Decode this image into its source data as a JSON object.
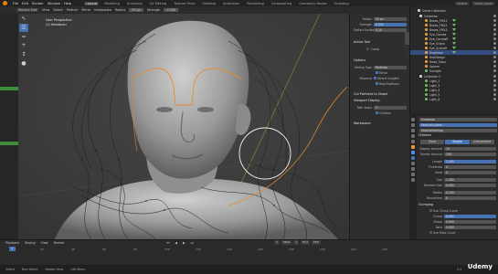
{
  "topbar": {
    "menus": [
      "File",
      "Edit",
      "Render",
      "Window",
      "Help"
    ],
    "workspaces": [
      "Layout",
      "Modeling",
      "Sculpting",
      "UV Editing",
      "Texture Paint",
      "Shading",
      "Animation",
      "Rendering",
      "Compositing",
      "Geometry Nodes",
      "Scripting"
    ],
    "active_workspace": "Layout",
    "scene": "Scene",
    "view_layer": "View Layer"
  },
  "viewport_header": {
    "mode": "Particle Edit",
    "items": [
      "View",
      "Select",
      "Particle"
    ],
    "mirror": "Mirror",
    "interpolate": "Interpolate",
    "radius_label": "Radius",
    "radius": "50 px",
    "strength_label": "Strength",
    "strength": "0.500"
  },
  "viewport_info": {
    "line1": "User Perspective",
    "line2": "(1) Headscan"
  },
  "npanel": {
    "header_fields": [
      {
        "label": "Radius",
        "value": "50 px"
      },
      {
        "label": "Strength",
        "value": "0.500"
      },
      {
        "label": "Deflect Emitter",
        "value": "0.10"
      }
    ],
    "active_tool": "Active Tool",
    "tool_name": "Comb",
    "options": "Options",
    "editing_type_label": "Editing Type",
    "editing_type": "Particles",
    "mirror": "Mirror",
    "preserve": "Preserve",
    "strand_lengths": "Strand Lengths",
    "root_positions": "Root Positions",
    "cut_particles": "Cut Particles to Shape",
    "viewport_display": "Viewport Display",
    "path_steps_label": "Path Steps",
    "path_steps": "3",
    "children": "Children",
    "workspace": "Workspace"
  },
  "outliner": {
    "title": "Scene Collection",
    "rows": [
      {
        "name": "Collection",
        "level": 0
      },
      {
        "name": "Brows_FRIL1",
        "level": 1
      },
      {
        "name": "Brows_FRIL2",
        "level": 1
      },
      {
        "name": "Brows_FRIL3",
        "level": 1
      },
      {
        "name": "Eye_Cornea",
        "level": 1
      },
      {
        "name": "Eye_CorneaR",
        "level": 1
      },
      {
        "name": "Eye_Sclera",
        "level": 1
      },
      {
        "name": "Eye_ScleraR",
        "level": 1
      },
      {
        "name": "Headscan",
        "level": 1,
        "selected": true
      },
      {
        "name": "HairDesign",
        "level": 1
      },
      {
        "name": "Head_Tplus",
        "level": 1
      },
      {
        "name": "Sphere",
        "level": 1
      },
      {
        "name": "Sunlight",
        "level": 1
      },
      {
        "name": "Collection 2",
        "level": 0
      },
      {
        "name": "Light_2",
        "level": 1
      },
      {
        "name": "Light_3",
        "level": 1
      },
      {
        "name": "Light_4",
        "level": 1
      },
      {
        "name": "Light_5",
        "level": 1
      },
      {
        "name": "Light_6",
        "level": 1
      }
    ]
  },
  "properties": {
    "object": "Headscan",
    "system": "ParticleSystem",
    "settings": "ParticleSettings",
    "children_section": "Children",
    "tabs": [
      "None",
      "Simple",
      "Interpolated"
    ],
    "active_tab": "Simple",
    "rows": [
      {
        "label": "Display Amount",
        "value": "10"
      },
      {
        "label": "Render Amount",
        "value": "100"
      },
      {
        "label": "Length",
        "value": "1.000"
      },
      {
        "label": "Threshold",
        "value": "0"
      },
      {
        "label": "Seed",
        "value": "0"
      },
      {
        "label": "Size",
        "value": "1.000"
      },
      {
        "label": "Random Size",
        "value": "0.000"
      },
      {
        "label": "Radius",
        "value": "0.200"
      },
      {
        "label": "Roundness",
        "value": "0"
      }
    ],
    "clumping": "Clumping",
    "use_clump_curve": "Use Clump Curve",
    "clump_rows": [
      {
        "label": "Clump",
        "value": "0.000"
      },
      {
        "label": "Shape",
        "value": "0.000"
      },
      {
        "label": "Twist",
        "value": "0.000"
      }
    ],
    "use_twist_curve": "Use Twist Curve",
    "clump_noise": "Clump Noise",
    "roughness": "Roughness",
    "kink": "Kink",
    "hair_shape": "Hair Shape",
    "strand_steps_label": "Strand Steps",
    "strand_steps": "3",
    "diameter_root_label": "Diameter Root",
    "diameter_root": "1.00"
  },
  "timeline": {
    "items": [
      "Playback",
      "Keying",
      "View",
      "Marker"
    ],
    "current_frame": "1",
    "start_label": "Start",
    "start": "1",
    "end_label": "End",
    "end": "250",
    "ticks": [
      "0",
      "20",
      "40",
      "60",
      "80",
      "100",
      "120",
      "140",
      "160",
      "180",
      "200",
      "220",
      "240"
    ]
  },
  "statusbar": {
    "items": [
      "Select",
      "Box Select",
      "Rotate View",
      "Call Menu"
    ],
    "version": "3.4"
  },
  "watermark": "Udemy"
}
